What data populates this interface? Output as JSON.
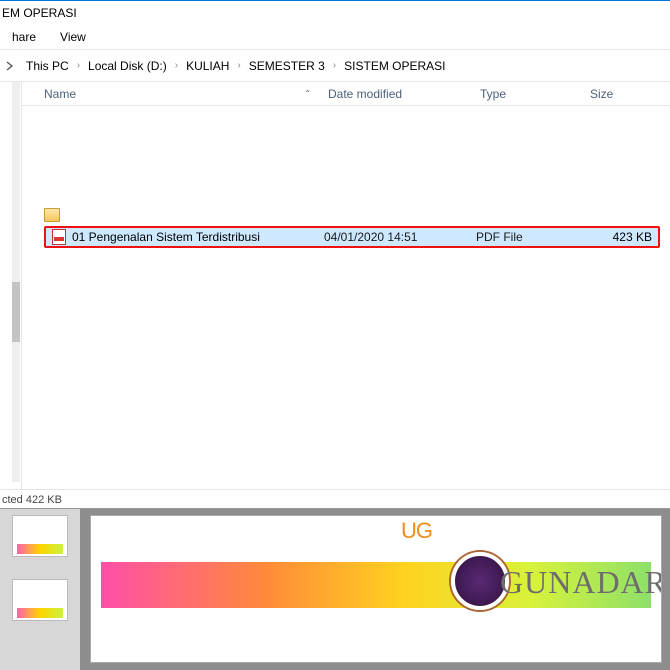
{
  "title": "EM OPERASI",
  "menu": {
    "share": "hare",
    "view": "View"
  },
  "breadcrumb": [
    "This PC",
    "Local Disk (D:)",
    "KULIAH",
    "SEMESTER 3",
    "SISTEM OPERASI"
  ],
  "columns": {
    "name": "Name",
    "date": "Date modified",
    "type": "Type",
    "size": "Size"
  },
  "file": {
    "name": "01 Pengenalan Sistem Terdistribusi",
    "date": "04/01/2020 14:51",
    "type": "PDF File",
    "size": "423 KB"
  },
  "status": "cted  422 KB",
  "brand": "GUNADAR",
  "ug": "UG"
}
